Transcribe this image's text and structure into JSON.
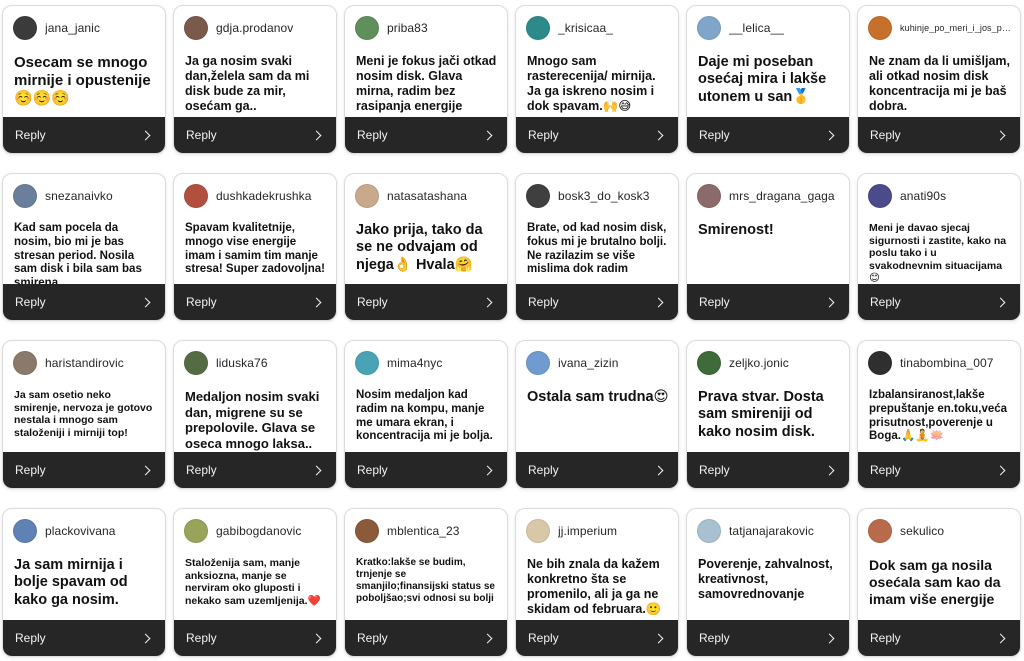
{
  "reply_label": "Reply",
  "cards": [
    {
      "username": "jana_janic",
      "message": "Osecam se mnogo mirnije i opustenije ☺️☺️☺️",
      "avatar_color": "#3b3b3b",
      "size": 15
    },
    {
      "username": "gdja.prodanov",
      "message": "Ja ga nosim svaki dan,želela sam da mi disk bude za mir, osećam ga..",
      "avatar_color": "#7a5a4a",
      "size": 12.5
    },
    {
      "username": "priba83",
      "message": "Meni je fokus jači otkad nosim disk. Glava mirna, radim bez rasipanja energije",
      "avatar_color": "#5f8f5a",
      "size": 12.5
    },
    {
      "username": "_krisicaa_",
      "message": "Mnogo sam rasterecenija/ mirnija. Ja ga iskreno nosim i dok spavam.🙌😅",
      "avatar_color": "#2c8a8a",
      "size": 12.5
    },
    {
      "username": "__lelica__",
      "message": "Daje mi poseban osećaj mira i lakše utonem u san🥇",
      "avatar_color": "#7fa5c9",
      "size": 14.5
    },
    {
      "username": "kuhinje_po_meri_i_jos_po...",
      "message": "Ne znam da li umišljam, ali otkad nosim disk koncentracija mi je baš dobra.",
      "avatar_color": "#c8702a",
      "size": 12.5
    },
    {
      "username": "snezanaivko",
      "message": "Kad sam pocela da nosim, bio mi je bas stresan period. Nosila sam disk i bila sam bas smirena.",
      "avatar_color": "#6a7f9c",
      "size": 11.5
    },
    {
      "username": "dushkadekrushka",
      "message": "Spavam kvalitetnije, mnogo vise energije imam i samim tim manje stresa! Super zadovoljna!",
      "avatar_color": "#b2503f",
      "size": 11.5
    },
    {
      "username": "natasatashana",
      "message": "Jako prija, tako da se ne odvajam od njega👌 Hvala🤗",
      "avatar_color": "#c9a98b",
      "size": 14.5
    },
    {
      "username": "bosk3_do_kosk3",
      "message": "Brate, od kad nosim disk, fokus mi je brutalno bolji. Ne razilazim se više mislima dok radim",
      "avatar_color": "#3f3f3f",
      "size": 11.5
    },
    {
      "username": "mrs_dragana_gaga",
      "message": "Smirenost!",
      "avatar_color": "#8a6a6a",
      "size": 14.5
    },
    {
      "username": "anati90s",
      "message": "Meni je davao sjecaj sigurnosti i zastite, kako na poslu tako i u svakodnevnim situacijama 😊",
      "avatar_color": "#4b4a8a",
      "size": 10.5
    },
    {
      "username": "haristandirovic",
      "message": "Ja sam osetio neko smirenje, nervoza je gotovo nestala i mnogo sam staloženiji i mirniji top!",
      "avatar_color": "#8a7a6a",
      "size": 10.5
    },
    {
      "username": "liduska76",
      "message": "Medaljon nosim svaki dan, migrene su se prepolovile. Glava se oseca mnogo laksa..",
      "avatar_color": "#556b44",
      "size": 13
    },
    {
      "username": "mima4nyc",
      "message": "Nosim medaljon kad radim na kompu, manje me umara ekran, i koncentracija mi je bolja.",
      "avatar_color": "#4aa3b5",
      "size": 11.5
    },
    {
      "username": "ivana_zizin",
      "message": "Ostala sam trudna😍",
      "avatar_color": "#6f9bd0",
      "size": 14.5
    },
    {
      "username": "zeljko.jonic",
      "message": "Prava stvar. Dosta sam smireniji od kako nosim disk.",
      "avatar_color": "#3f6a3a",
      "size": 14.5
    },
    {
      "username": "tinabombina_007",
      "message": "Izbalansiranost,lakše prepuštanje en.toku,veća prisutnost,poverenje u Boga.🙏🧘🪷",
      "avatar_color": "#2f2f2f",
      "size": 11.5
    },
    {
      "username": "plackovivana",
      "message": "Ja sam mirnija i bolje spavam od kako ga nosim.",
      "avatar_color": "#5e82b5",
      "size": 14.5
    },
    {
      "username": "gabibogdanovic",
      "message": "Staloženija sam, manje anksiozna, manje se nerviram oko gluposti i nekako sam uzemljenija.❤️",
      "avatar_color": "#9aa35a",
      "size": 10.5
    },
    {
      "username": "mblentica_23",
      "message": "Kratko:lakše se budim, trnjenje se smanjilo;finansijski status se poboljšao;svi odnosi su bolji",
      "avatar_color": "#8a5a3a",
      "size": 10
    },
    {
      "username": "jj.imperium",
      "message": "Ne bih znala da kažem konkretno šta se promenilo, ali ja ga ne skidam od februara.🙂",
      "avatar_color": "#d8c8a8",
      "size": 12.5
    },
    {
      "username": "tatjanajarakovic",
      "message": "Poverenje, zahvalnost, kreativnost, samovrednovanje",
      "avatar_color": "#a8c0d0",
      "size": 12.5
    },
    {
      "username": "sekulico",
      "message": "Dok sam ga nosila osećala sam kao da imam više energije",
      "avatar_color": "#b86a4a",
      "size": 14
    }
  ]
}
